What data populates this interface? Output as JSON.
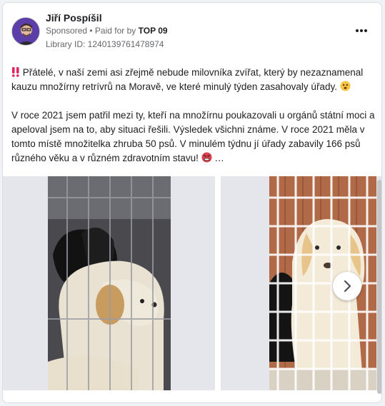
{
  "ad": {
    "author": "Jiří Pospíšil",
    "sponsored_label": "Sponsored",
    "paid_for_prefix": " • Paid for by ",
    "paid_for_by": "TOP 09",
    "library_id": "Library ID: 1240139761478974"
  },
  "post": {
    "paragraph1_text": "Přátelé, v naší zemi asi zřejmě nebude milovníka zvířat, který by nezaznamenal kauzu množírny retrívrů na Moravě, ve které minulý týden zasahovaly úřady.",
    "paragraph2_text": "V roce 2021 jsem patřil mezi ty, kteří na množírnu poukazovali u orgánů státní moci a apeloval jsem na to, aby situaci řešili. Výsledek všichni známe. V roce 2021 měla v tomto místě množitelka zhruba 50 psů. V minulém týdnu jí úřady zabavily 166 psů různého věku a v různém zdravotním stavu!",
    "ellipsis": "…",
    "icons": [
      "double-exclamation-icon",
      "worried-face-icon",
      "angry-face-icon"
    ]
  },
  "carousel": {
    "images": [
      "dogs-in-cage-photo",
      "golden-retriever-behind-fence-photo"
    ],
    "next_icon": "chevron-right-icon"
  },
  "colors": {
    "avatar_bg": "#5b3ea8",
    "exclamation": "#e0245e",
    "meta_text": "#65676b"
  }
}
